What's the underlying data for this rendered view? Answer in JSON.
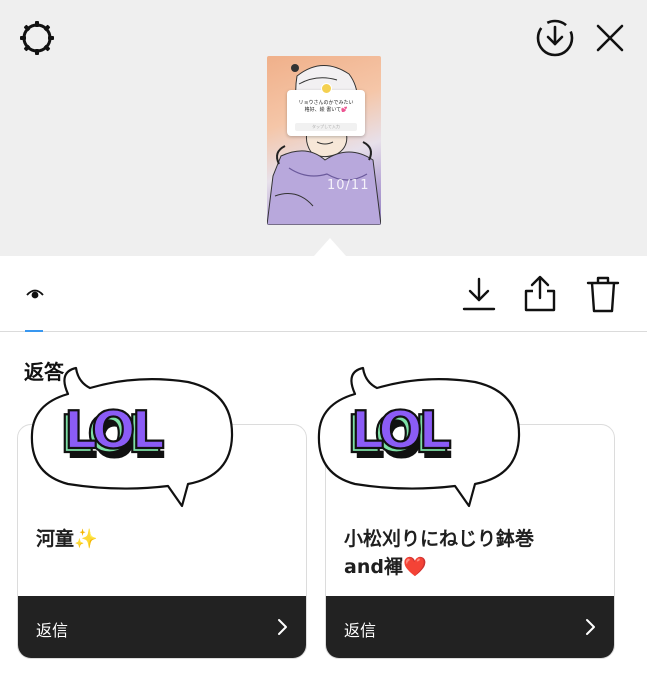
{
  "story_preview": {
    "question": "リョウさんのかでみたい\n格好、絵 書いて💕",
    "reply_hint": "タップして入力",
    "date_text": "10/11"
  },
  "replies": {
    "title": "返答",
    "items": [
      {
        "answer": "河童✨",
        "reply_label": "返信",
        "sticker_text": "LOL"
      },
      {
        "answer": "小松刈りにねじり鉢巻\nand褌❤️",
        "reply_label": "返信",
        "sticker_text": "LOL"
      }
    ]
  },
  "colors": {
    "accent": "#3897f0",
    "footer": "#222222",
    "sticker_purple": "#8b5cf6",
    "sticker_green": "#7ee0a6"
  },
  "icons": {
    "settings": "gear-icon",
    "download_circle": "download-circle-icon",
    "close": "close-icon",
    "eye": "eye-icon",
    "download": "download-icon",
    "share": "share-icon",
    "trash": "trash-icon",
    "chevron": "chevron-right-icon"
  }
}
